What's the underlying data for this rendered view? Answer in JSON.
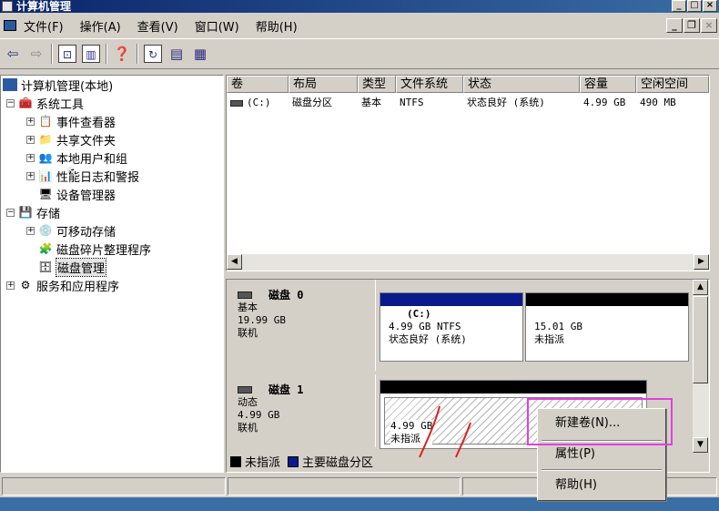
{
  "window": {
    "title": "计算机管理"
  },
  "menu": [
    "文件(F)",
    "操作(A)",
    "查看(V)",
    "窗口(W)",
    "帮助(H)"
  ],
  "tree": {
    "root": "计算机管理(本地)",
    "system_tools": "系统工具",
    "event_viewer": "事件查看器",
    "shared_folders": "共享文件夹",
    "local_users": "本地用户和组",
    "perf_logs": "性能日志和警报",
    "device_manager": "设备管理器",
    "storage": "存储",
    "removable": "可移动存储",
    "defrag": "磁盘碎片整理程序",
    "disk_mgmt": "磁盘管理",
    "services": "服务和应用程序"
  },
  "volume_list": {
    "columns": [
      "卷",
      "布局",
      "类型",
      "文件系统",
      "状态",
      "容量",
      "空闲空间"
    ],
    "rows": [
      {
        "volume": "(C:)",
        "layout": "磁盘分区",
        "type": "基本",
        "fs": "NTFS",
        "status": "状态良好 (系统)",
        "capacity": "4.99 GB",
        "free": "490 MB"
      }
    ]
  },
  "disks": [
    {
      "name": "磁盘 0",
      "type": "基本",
      "size": "19.99 GB",
      "status": "联机",
      "partitions": [
        {
          "label": "(C:)",
          "detail": "4.99 GB NTFS",
          "status": "状态良好 (系统)"
        },
        {
          "label": "",
          "detail": "15.01 GB",
          "status": "未指派"
        }
      ]
    },
    {
      "name": "磁盘 1",
      "type": "动态",
      "size": "4.99 GB",
      "status": "联机",
      "partitions": [
        {
          "detail": "4.99 GB",
          "status": "未指派"
        }
      ]
    }
  ],
  "legend": {
    "unallocated": "未指派",
    "primary": "主要磁盘分区"
  },
  "context_menu": {
    "new_volume": "新建卷(N)...",
    "properties": "属性(P)",
    "help": "帮助(H)"
  },
  "colors": {
    "primary_partition": "#0a1a8c",
    "unallocated": "#000000",
    "highlight": "#e040e0",
    "annotation": "#e0201c"
  }
}
